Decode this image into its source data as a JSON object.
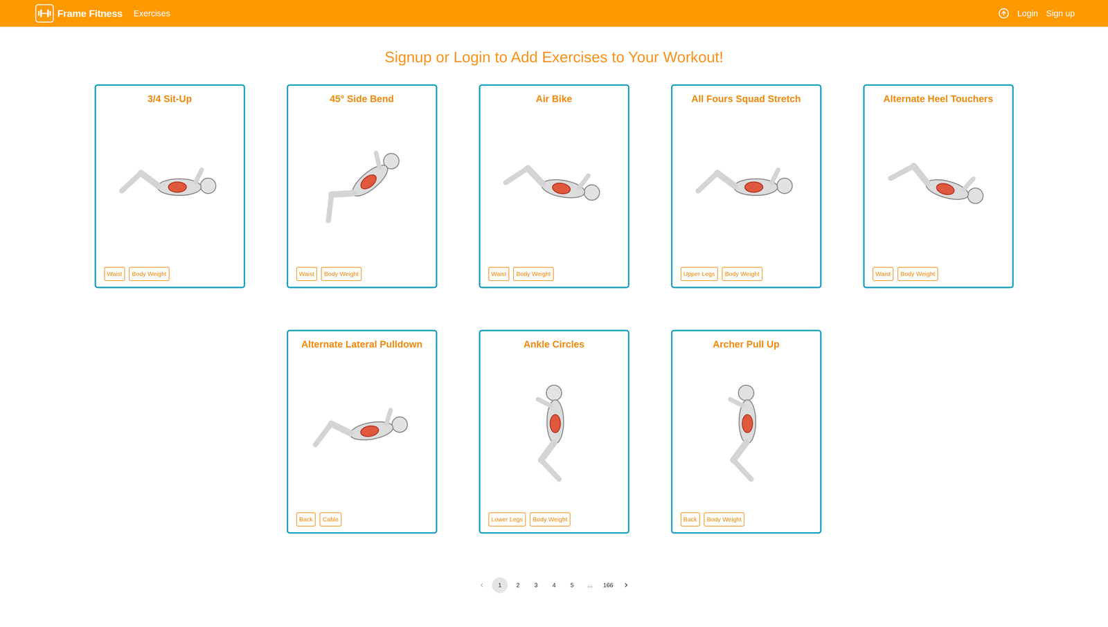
{
  "navbar": {
    "brand": "Frame Fitness",
    "links": [
      {
        "label": "Exercises"
      }
    ],
    "auth_links": [
      {
        "label": "Login"
      },
      {
        "label": "Sign up"
      }
    ]
  },
  "heading": "Signup or Login to Add Exercises to Your Workout!",
  "exercises": [
    {
      "name": "3/4 Sit-Up",
      "tags": [
        "Waist",
        "Body Weight"
      ]
    },
    {
      "name": "45° Side Bend",
      "tags": [
        "Waist",
        "Body Weight"
      ]
    },
    {
      "name": "Air Bike",
      "tags": [
        "Waist",
        "Body Weight"
      ]
    },
    {
      "name": "All Fours Squad Stretch",
      "tags": [
        "Upper Legs",
        "Body Weight"
      ]
    },
    {
      "name": "Alternate Heel Touchers",
      "tags": [
        "Waist",
        "Body Weight"
      ]
    },
    {
      "name": "Alternate Lateral Pulldown",
      "tags": [
        "Back",
        "Cable"
      ]
    },
    {
      "name": "Ankle Circles",
      "tags": [
        "Lower Legs",
        "Body Weight"
      ]
    },
    {
      "name": "Archer Pull Up",
      "tags": [
        "Back",
        "Body Weight"
      ]
    }
  ],
  "pagination": {
    "prev": {
      "disabled": true
    },
    "next": {
      "disabled": false
    },
    "pages": [
      {
        "label": "1",
        "selected": true
      },
      {
        "label": "2",
        "selected": false
      },
      {
        "label": "3",
        "selected": false
      },
      {
        "label": "4",
        "selected": false
      },
      {
        "label": "5",
        "selected": false
      },
      {
        "label": "...",
        "selected": false
      },
      {
        "label": "166",
        "selected": false
      }
    ]
  }
}
